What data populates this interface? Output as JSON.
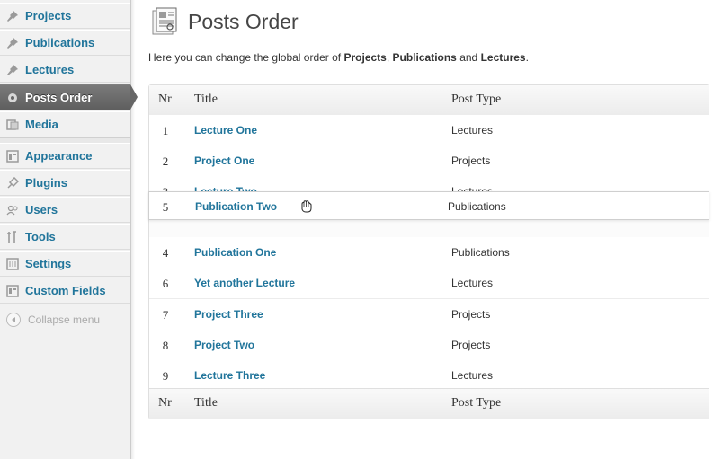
{
  "sidebar": {
    "items": [
      {
        "label": "Projects",
        "icon": "pushpin-icon"
      },
      {
        "label": "Publications",
        "icon": "pushpin-icon"
      },
      {
        "label": "Lectures",
        "icon": "pushpin-icon"
      },
      {
        "label": "Posts Order",
        "icon": "gear-icon",
        "current": true
      },
      {
        "label": "Media",
        "icon": "media-icon"
      },
      {
        "label": "Appearance",
        "icon": "appearance-icon"
      },
      {
        "label": "Plugins",
        "icon": "plugin-icon"
      },
      {
        "label": "Users",
        "icon": "users-icon"
      },
      {
        "label": "Tools",
        "icon": "tools-icon"
      },
      {
        "label": "Settings",
        "icon": "settings-icon"
      },
      {
        "label": "Custom Fields",
        "icon": "custom-fields-icon"
      }
    ],
    "collapse_label": "Collapse menu"
  },
  "page": {
    "title": "Posts Order",
    "intro_prefix": "Here you can change the global order of ",
    "intro_bold_1": "Projects",
    "intro_sep_1": ", ",
    "intro_bold_2": "Publications",
    "intro_sep_2": " and ",
    "intro_bold_3": "Lectures",
    "intro_suffix": "."
  },
  "table": {
    "headers": {
      "nr": "Nr",
      "title": "Title",
      "post_type": "Post Type"
    },
    "rows": [
      {
        "nr": "1",
        "title": "Lecture One",
        "post_type": "Lectures"
      },
      {
        "nr": "2",
        "title": "Project One",
        "post_type": "Projects"
      },
      {
        "nr": "3",
        "title": "Lecture Two",
        "post_type": "Lectures"
      },
      {
        "nr": "4",
        "title": "Publication One",
        "post_type": "Publications"
      },
      {
        "nr": "6",
        "title": "Yet another Lecture",
        "post_type": "Lectures"
      },
      {
        "nr": "7",
        "title": "Project Three",
        "post_type": "Projects"
      },
      {
        "nr": "8",
        "title": "Project Two",
        "post_type": "Projects"
      },
      {
        "nr": "9",
        "title": "Lecture Three",
        "post_type": "Lectures"
      }
    ],
    "dragging_row": {
      "nr": "5",
      "title": "Publication Two",
      "post_type": "Publications"
    }
  },
  "colors": {
    "link": "#21759b",
    "sidebar_bg": "#f1f1f1",
    "current_menu_bg": "#6d6d6d"
  }
}
